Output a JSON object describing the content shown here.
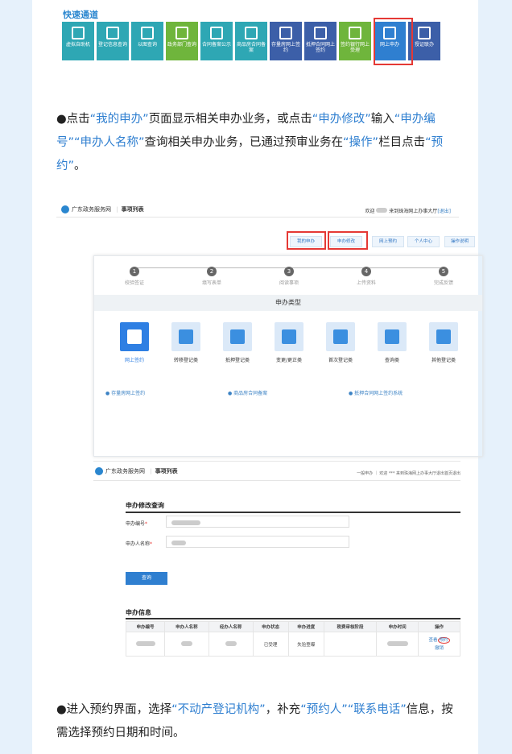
{
  "quick": {
    "title": "快速通道",
    "items": [
      {
        "label": "虚拟自助机",
        "color": "#2ea7b4"
      },
      {
        "label": "登记信息查询",
        "color": "#2ea7b4"
      },
      {
        "label": "以图查询",
        "color": "#2ea7b4"
      },
      {
        "label": "政务部门查询",
        "color": "#6fb53c"
      },
      {
        "label": "合同备案公示",
        "color": "#2ea7b4"
      },
      {
        "label": "商品房合同备案",
        "color": "#2ea7b4"
      },
      {
        "label": "存量房网上签约",
        "color": "#3c5fa8"
      },
      {
        "label": "抵押合同网上签约",
        "color": "#3c5fa8"
      },
      {
        "label": "签约银行网上受理",
        "color": "#6fb53c"
      },
      {
        "label": "网上申办",
        "color": "#2f7fd0"
      },
      {
        "label": "授证联办",
        "color": "#3c5fa8"
      }
    ]
  },
  "para1": {
    "a": "●点击",
    "b": "“我的申办”",
    "c": "页面显示相关申办业务，或点击",
    "d": "“申办修改”",
    "e": "输入",
    "f": "“申办编号”",
    "g": "“申办人名称”",
    "h": "查询相关申办业务，已通过预审业务在",
    "i": "“操作”",
    "j": "栏目点击",
    "k": "“预约”",
    "l": "。"
  },
  "s1": {
    "site": "广东政务服务网",
    "list": "事项列表",
    "welcome": "欢迎",
    "welcome2": "来到珠海网上办事大厅",
    "exit": "[退出]",
    "tabs": [
      "我的申办",
      "申办修改",
      "网上预约",
      "个人中心",
      "操作说明"
    ],
    "steps": [
      "校验签证",
      "填写表单",
      "阅读事项",
      "上传资料",
      "完成反馈"
    ],
    "band": "申办类型",
    "cats": [
      "网上签约",
      "转移登记类",
      "抵押登记类",
      "变更/更正类",
      "首次登记类",
      "查询类",
      "其他登记类"
    ],
    "links": [
      "● 存量房网上签约",
      "● 商品房合同备案",
      "● 抵押合同网上签约系统"
    ]
  },
  "s2": {
    "site": "广东政务服务网",
    "list": "事项列表",
    "topright": "一般申办 ｜ 欢迎 *** 来到珠海网上办事大厅退出首页退出",
    "title": "申办修改查询",
    "f1": "申办编号",
    "f2": "申办人名称",
    "btn": "查询",
    "info": "申办信息",
    "cols": [
      "申办编号",
      "申办人名称",
      "经办人名称",
      "申办状态",
      "申办进度",
      "税费审核阶段",
      "申办时间",
      "操作"
    ],
    "row": [
      "",
      "",
      "",
      "已受理",
      "失验登曝",
      "",
      "",
      ""
    ],
    "ops": [
      "查看",
      "预约",
      "撤销"
    ]
  },
  "para2": {
    "a": "●进入预约界面，选择",
    "b": "“不动产登记机构”",
    "c": "，补充",
    "d": "“预约人”",
    "e": "“联系电话”",
    "f": "信息，按需选择预约日期和时间。"
  }
}
